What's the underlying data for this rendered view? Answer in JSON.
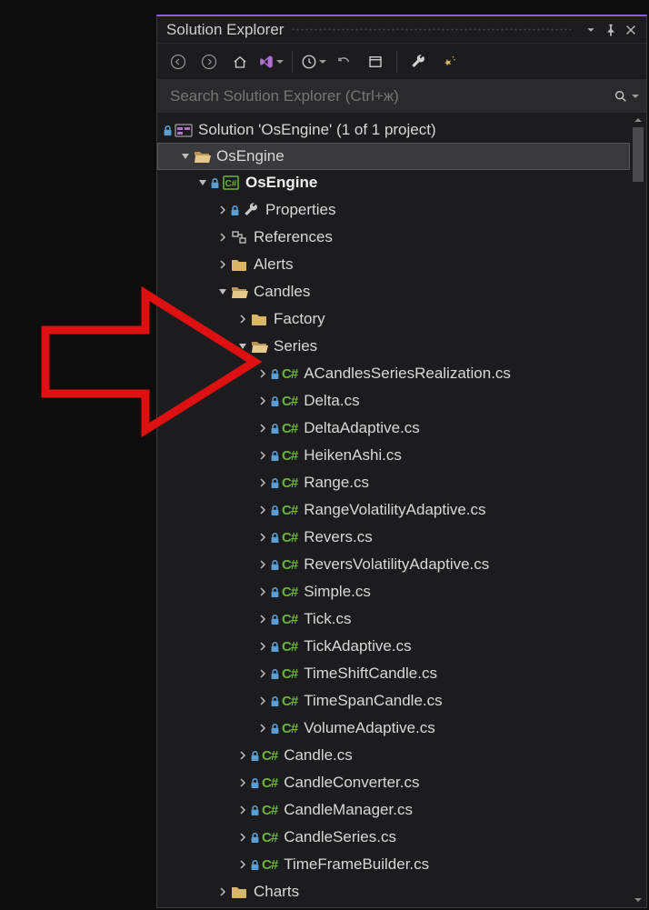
{
  "title": "Solution Explorer",
  "search": {
    "placeholder": "Search Solution Explorer (Ctrl+ж)"
  },
  "solution": {
    "label": "Solution 'OsEngine' (1 of 1 project)",
    "project": {
      "name": "OsEngine",
      "projnode": "OsEngine",
      "properties": "Properties",
      "references": "References",
      "folders": {
        "alerts": "Alerts",
        "candles": "Candles",
        "factory": "Factory",
        "series": "Series",
        "charts": "Charts"
      },
      "series_files": [
        "ACandlesSeriesRealization.cs",
        "Delta.cs",
        "DeltaAdaptive.cs",
        "HeikenAshi.cs",
        "Range.cs",
        "RangeVolatilityAdaptive.cs",
        "Revers.cs",
        "ReversVolatilityAdaptive.cs",
        "Simple.cs",
        "Tick.cs",
        "TickAdaptive.cs",
        "TimeShiftCandle.cs",
        "TimeSpanCandle.cs",
        "VolumeAdaptive.cs"
      ],
      "candles_files": [
        "Candle.cs",
        "CandleConverter.cs",
        "CandleManager.cs",
        "CandleSeries.cs",
        "TimeFrameBuilder.cs"
      ]
    }
  }
}
